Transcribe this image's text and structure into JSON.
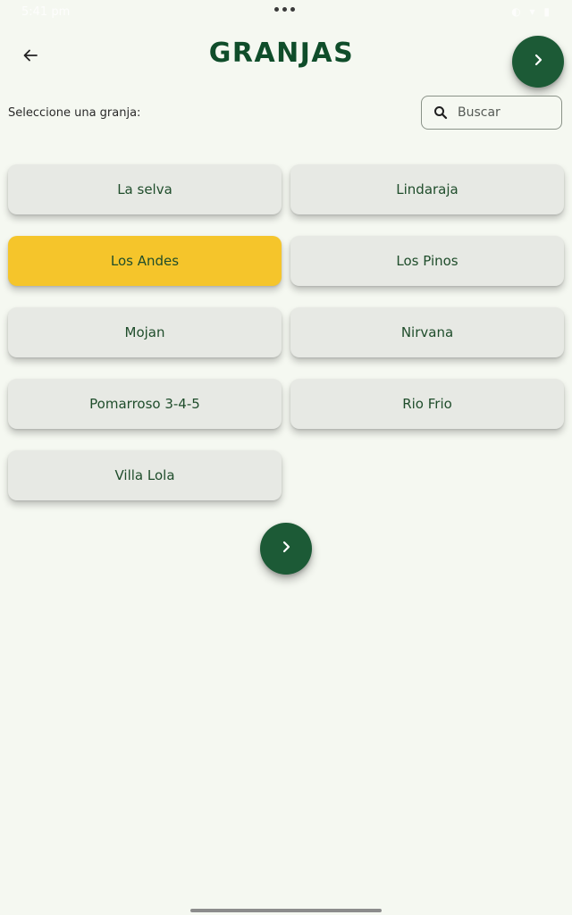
{
  "status_bar": {
    "time": "5:41 pm",
    "icons": "◐ ▾ ▮"
  },
  "header": {
    "title": "GRANJAS",
    "back_icon": "arrow-left-icon",
    "next_icon": "chevron-right-icon"
  },
  "selection": {
    "label": "Seleccione una granja:"
  },
  "search": {
    "placeholder": "Buscar",
    "value": "",
    "icon": "search-icon"
  },
  "farms": [
    {
      "label": "La selva",
      "selected": false
    },
    {
      "label": "Lindaraja",
      "selected": false
    },
    {
      "label": "Los Andes",
      "selected": true
    },
    {
      "label": "Los Pinos",
      "selected": false
    },
    {
      "label": "Mojan",
      "selected": false
    },
    {
      "label": "Nirvana",
      "selected": false
    },
    {
      "label": "Pomarroso 3-4-5",
      "selected": false
    },
    {
      "label": "Rio Frio",
      "selected": false
    },
    {
      "label": "Villa Lola",
      "selected": false
    }
  ],
  "colors": {
    "background": "#f5f8f1",
    "primary": "#1c5a36",
    "title": "#0f4d2a",
    "card": "#e7e9e4",
    "selected_card": "#f5c52b"
  }
}
